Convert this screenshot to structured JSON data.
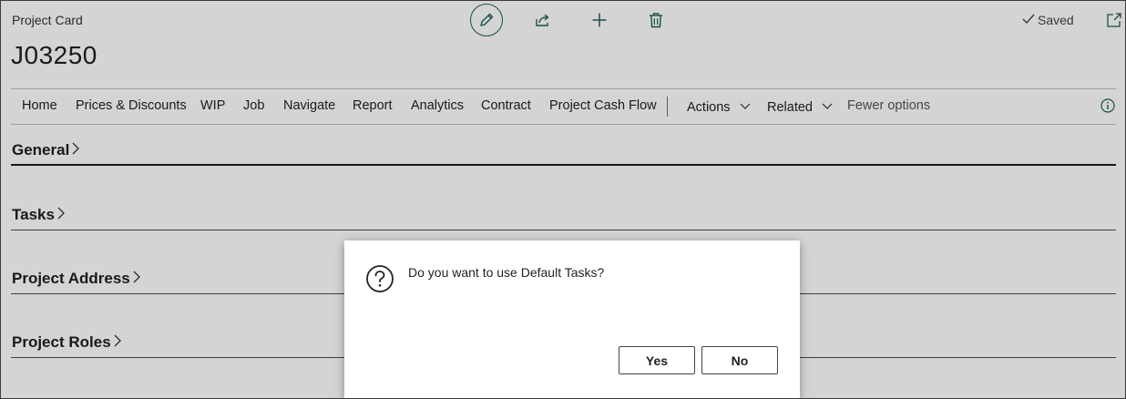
{
  "header": {
    "caption": "Project Card",
    "title": "J03250",
    "saved_label": "Saved",
    "icons": [
      "edit-icon",
      "share-icon",
      "plus-icon",
      "delete-icon",
      "checkmark-icon",
      "pop-out-icon"
    ]
  },
  "action_bar": {
    "items": [
      "Home",
      "Prices & Discounts",
      "WIP",
      "Job",
      "Navigate",
      "Report",
      "Analytics",
      "Contract",
      "Project Cash Flow"
    ],
    "actions_label": "Actions",
    "related_label": "Related",
    "fewer_options_label": "Fewer options"
  },
  "sections": [
    "General",
    "Tasks",
    "Project Address",
    "Project Roles"
  ],
  "dialog": {
    "message": "Do you want to use Default Tasks?",
    "yes_label": "Yes",
    "no_label": "No",
    "icon": "question-icon"
  },
  "colors": {
    "accent": "#1e5e56",
    "overlay": "rgba(0,0,0,0.17)"
  }
}
